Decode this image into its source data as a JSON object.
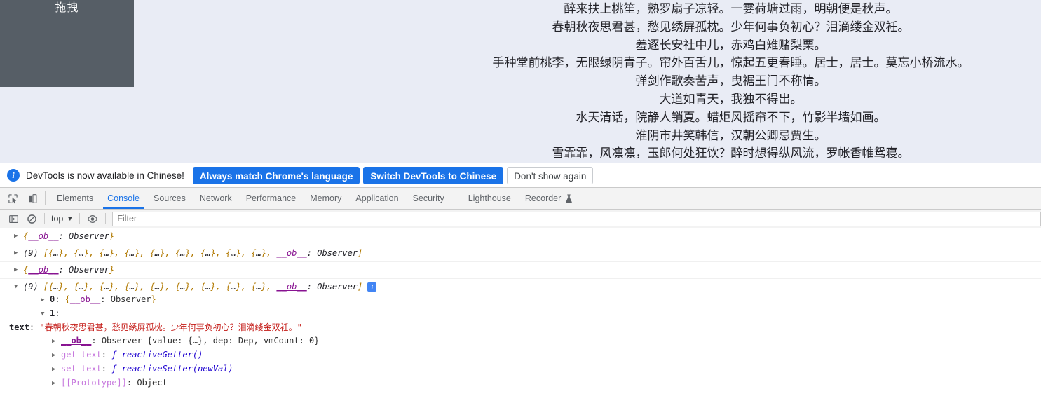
{
  "page": {
    "drag_panel_label": "拖拽",
    "poem_lines": [
      "醉来扶上桃笙，熟罗扇子凉轻。一霎荷塘过雨，明朝便是秋声。",
      "春朝秋夜思君甚，愁见绣屏孤枕。少年何事负初心？泪滴缕金双衽。",
      "羞逐长安社中儿，赤鸡白雉赌梨栗。",
      "手种堂前桃李，无限绿阴青子。帘外百舌儿，惊起五更春睡。居士，居士。莫忘小桥流水。",
      "弹剑作歌奏苦声，曳裾王门不称情。",
      "大道如青天，我独不得出。",
      "水天清话，院静人销夏。蜡炬风摇帘不下，竹影半墙如画。",
      "淮阴市井笑韩信，汉朝公卿忌贾生。",
      "雪霏霏，风凛凛，玉郎何处狂饮？醉时想得纵风流，罗帐香帷鸳寝。"
    ]
  },
  "devtools": {
    "locale_bar": {
      "icon": "info-circle-icon",
      "message": "DevTools is now available in Chinese!",
      "primary_button": "Always match Chrome's language",
      "secondary_button": "Switch DevTools to Chinese",
      "dismiss_button": "Don't show again"
    },
    "tabbar": {
      "inspect_icon": "inspect-element-icon",
      "device_icon": "device-toolbar-icon",
      "tabs": [
        {
          "label": "Elements",
          "active": false
        },
        {
          "label": "Console",
          "active": true
        },
        {
          "label": "Sources",
          "active": false
        },
        {
          "label": "Network",
          "active": false
        },
        {
          "label": "Performance",
          "active": false
        },
        {
          "label": "Memory",
          "active": false
        },
        {
          "label": "Application",
          "active": false
        },
        {
          "label": "Security",
          "active": false
        },
        {
          "label": "Lighthouse",
          "active": false
        },
        {
          "label": "Recorder",
          "active": false,
          "icon": "flask-experimental-icon"
        }
      ]
    },
    "console_toolbar": {
      "sidebar_icon": "console-sidebar-icon",
      "clear_icon": "clear-console-icon",
      "context": "top",
      "caret": "▼",
      "eye_icon": "live-expression-eye-icon",
      "filter_placeholder": "Filter",
      "filter_value": ""
    },
    "console": {
      "messages": [
        {
          "id": "m1",
          "arrow": "▶",
          "expanded": false,
          "text": "{__ob__: Observer}"
        },
        {
          "id": "m2",
          "arrow": "▶",
          "expanded": false,
          "count": "(9)",
          "text": "(9) [{…}, {…}, {…}, {…}, {…}, {…}, {…}, {…}, {…}, __ob__: Observer]"
        },
        {
          "id": "m3",
          "arrow": "▶",
          "expanded": false,
          "text": "{__ob__: Observer}"
        },
        {
          "id": "m4",
          "arrow": "▼",
          "expanded": true,
          "count": "(9)",
          "text": "(9) [{…}, {…}, {…}, {…}, {…}, {…}, {…}, {…}, {…}, __ob__: Observer]",
          "badge": "i"
        }
      ],
      "expanded_properties": [
        {
          "arrow": "▶",
          "index": "0",
          "value": "{__ob__: Observer}"
        },
        {
          "arrow": "▼",
          "index": "1",
          "value": ""
        }
      ],
      "item1_props": {
        "text_key": "text",
        "text_value": "\"春朝秋夜思君甚，愁见绣屏孤枕。少年何事负初心？泪滴缕金双衽。\"",
        "ob_key": "__ob__",
        "ob_value": "Observer {value: {…}, dep: Dep, vmCount: 0}",
        "getter_label": "get text",
        "getter_fn": "ƒ reactiveGetter()",
        "setter_label": "set text",
        "setter_fn": "ƒ reactiveSetter(newVal)",
        "proto_label": "[[Prototype]]",
        "proto_value": "Object"
      }
    }
  },
  "colors": {
    "page_bg": "#e9ecf5",
    "drag_panel_bg": "#565e66",
    "accent_blue": "#1a73e8",
    "string_red": "#c41a16",
    "prop_purple": "#881391",
    "fn_blue": "#1c00cf"
  }
}
